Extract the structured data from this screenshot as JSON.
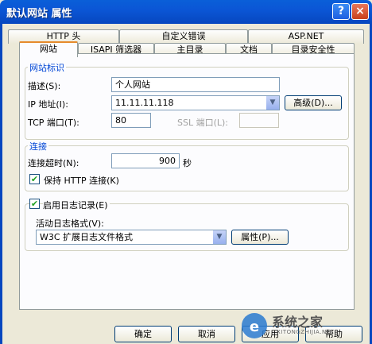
{
  "window": {
    "title": "默认网站 属性",
    "help_btn": "?",
    "close_btn": "×"
  },
  "tabs_row1": [
    "HTTP 头",
    "自定义错误",
    "ASP.NET"
  ],
  "tabs_row2": [
    "网站",
    "ISAPI 筛选器",
    "主目录",
    "文档",
    "目录安全性"
  ],
  "site_id": {
    "title": "网站标识",
    "desc_label": "描述(S):",
    "desc_value": "个人网站",
    "ip_label": "IP 地址(I):",
    "ip_value": "11.11.11.118",
    "advanced_btn": "高级(D)...",
    "tcp_label": "TCP 端口(T):",
    "tcp_value": "80",
    "ssl_label": "SSL 端口(L):",
    "ssl_value": ""
  },
  "connection": {
    "title": "连接",
    "timeout_label": "连接超时(N):",
    "timeout_value": "900",
    "timeout_unit": "秒",
    "keepalive_label": "保持 HTTP 连接(K)",
    "keepalive_checked": true
  },
  "logging": {
    "enable_label": "启用日志记录(E)",
    "enable_checked": true,
    "format_label": "活动日志格式(V):",
    "format_value": "W3C 扩展日志文件格式",
    "props_btn": "属性(P)..."
  },
  "bottom_buttons": {
    "ok": "确定",
    "cancel": "取消",
    "apply": "应用",
    "help": "帮助"
  },
  "watermark": {
    "text": "系统之家",
    "sub": "XITONGZHIJIA.NET"
  }
}
